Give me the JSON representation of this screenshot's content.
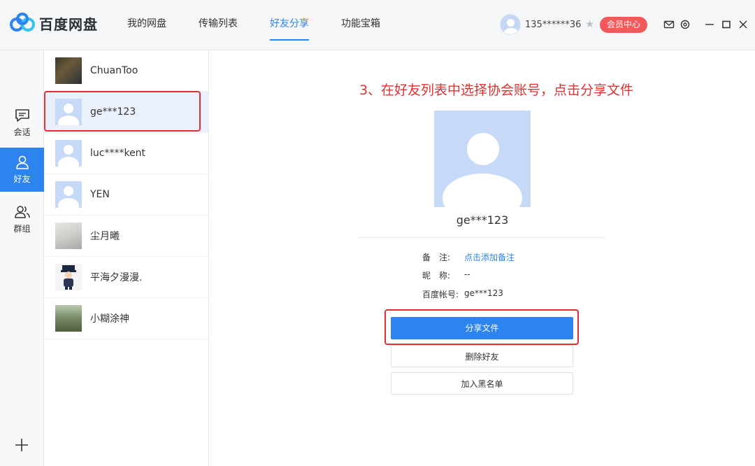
{
  "app": {
    "logo_text": "百度网盘",
    "colors": {
      "accent": "#2d84ee",
      "vip": "#f05a5a",
      "annotation": "#e03131"
    }
  },
  "nav": {
    "items": [
      {
        "label": "我的网盘",
        "active": false
      },
      {
        "label": "传输列表",
        "active": false
      },
      {
        "label": "好友分享",
        "active": true
      },
      {
        "label": "功能宝箱",
        "active": false
      }
    ]
  },
  "user": {
    "name": "135******36",
    "vip_button": "会员中心"
  },
  "window_icons": [
    "mail-icon",
    "settings-icon",
    "minimize-icon",
    "maximize-icon",
    "close-icon"
  ],
  "rail": {
    "items": [
      {
        "label": "会话",
        "icon": "chat-icon",
        "active": false
      },
      {
        "label": "好友",
        "icon": "person-icon",
        "active": true
      },
      {
        "label": "群组",
        "icon": "group-icon",
        "active": false
      }
    ],
    "add_icon": "plus-icon"
  },
  "friends": [
    {
      "name": "ChuanToo",
      "avatar": "photo"
    },
    {
      "name": "ge***123",
      "avatar": "default",
      "selected": true
    },
    {
      "name": "luc****kent",
      "avatar": "default"
    },
    {
      "name": "YEN",
      "avatar": "default"
    },
    {
      "name": "尘月曦",
      "avatar": "photo"
    },
    {
      "name": "平海夕漫漫.",
      "avatar": "cartoon"
    },
    {
      "name": "小糊涂神",
      "avatar": "photo"
    }
  ],
  "detail": {
    "instruction": "3、在好友列表中选择协会账号，点击分享文件",
    "name": "ge***123",
    "info": [
      {
        "label": "备　注:",
        "value": "点击添加备注",
        "link": true
      },
      {
        "label": "昵　称:",
        "value": "--",
        "link": false
      },
      {
        "label": "百度帐号:",
        "value": "ge***123",
        "link": false
      }
    ],
    "buttons": {
      "share": "分享文件",
      "delete": "删除好友",
      "blacklist": "加入黑名单"
    }
  }
}
